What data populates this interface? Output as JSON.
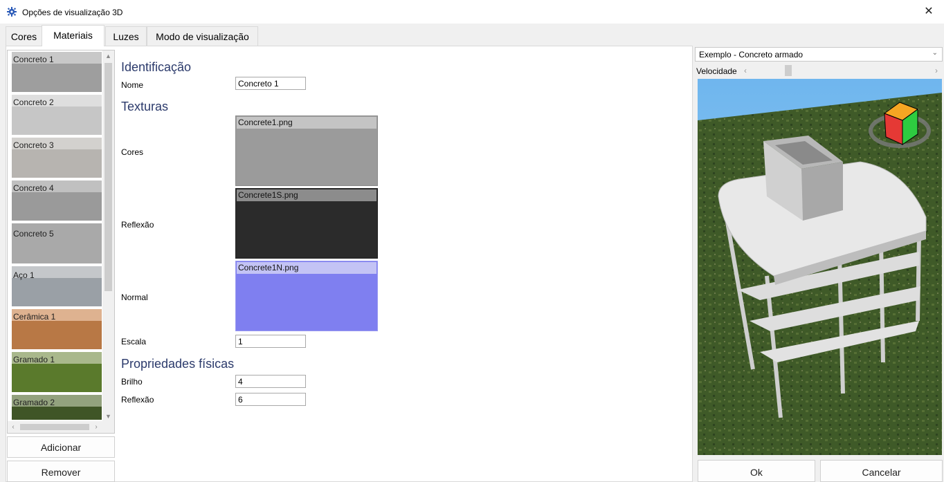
{
  "window": {
    "title": "Opções de visualização 3D",
    "close_glyph": "✕"
  },
  "tabs": [
    {
      "label": "Cores",
      "active": false
    },
    {
      "label": "Materiais",
      "active": true
    },
    {
      "label": "Luzes",
      "active": false
    },
    {
      "label": "Modo de visualização",
      "active": false
    }
  ],
  "materials": [
    {
      "label": "Concreto 1",
      "color": "#9e9e9e",
      "selected": true
    },
    {
      "label": "Concreto 2",
      "color": "#c6c6c6"
    },
    {
      "label": "Concreto 3",
      "color": "#b7b4b0"
    },
    {
      "label": "Concreto 4",
      "color": "#9a9a9a"
    },
    {
      "label": "Concreto 5",
      "color": "#a9a9a9"
    },
    {
      "label": "Aço 1",
      "color": "#9aa0a6"
    },
    {
      "label": "Cerâmica 1",
      "color": "#b87845"
    },
    {
      "label": "Gramado 1",
      "color": "#5a7a2c"
    },
    {
      "label": "Gramado 2",
      "color": "#3f5526"
    }
  ],
  "buttons": {
    "add": "Adicionar",
    "remove": "Remover",
    "ok": "Ok",
    "cancel": "Cancelar"
  },
  "identificacao": {
    "heading": "Identificação",
    "name_label": "Nome",
    "name_value": "Concreto 1"
  },
  "texturas": {
    "heading": "Texturas",
    "cores_label": "Cores",
    "cores_file": "Concrete1.png",
    "reflexao_label": "Reflexão",
    "reflexao_file": "Concrete1S.png",
    "normal_label": "Normal",
    "normal_file": "Concrete1N.png",
    "escala_label": "Escala",
    "escala_value": "1"
  },
  "fisicas": {
    "heading": "Propriedades físicas",
    "brilho_label": "Brilho",
    "brilho_value": "4",
    "reflexao_label": "Reflexão",
    "reflexao_value": "6"
  },
  "preview": {
    "example_selected": "Exemplo - Concreto armado",
    "speed_label": "Velocidade",
    "speed_fraction": 0.2
  },
  "icons": {
    "app": "gear-icon",
    "close": "close-icon",
    "combo": "chevron-down-icon",
    "scroll_up": "chevron-up-icon",
    "scroll_down": "chevron-down-icon",
    "scroll_left": "chevron-left-icon",
    "scroll_right": "chevron-right-icon",
    "cube": "navigation-cube-icon"
  },
  "colors": {
    "heading": "#2b3a6b",
    "accent_normal_map": "#7f7ff0",
    "sky": "#87c3f0",
    "grass": "#3f5a28"
  }
}
